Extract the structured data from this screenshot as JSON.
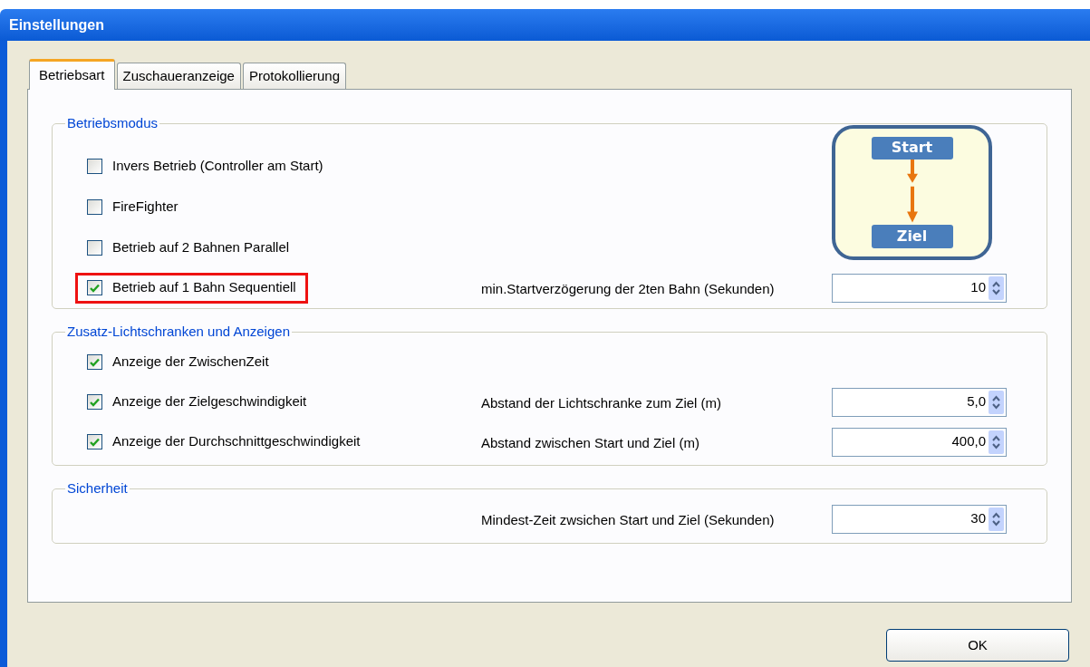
{
  "window": {
    "title": "Einstellungen"
  },
  "tabs": [
    {
      "label": "Betriebsart",
      "selected": true
    },
    {
      "label": "Zuschaueranzeige",
      "selected": false
    },
    {
      "label": "Protokollierung",
      "selected": false
    }
  ],
  "groups": [
    {
      "title": "Betriebsmodus",
      "diagram": {
        "from": "Start",
        "to": "Ziel"
      },
      "rows": [
        {
          "checkbox": {
            "label": "Invers Betrieb (Controller am Start)",
            "checked": false
          },
          "highlighted": false
        },
        {
          "checkbox": {
            "label": "FireFighter",
            "checked": false
          },
          "highlighted": false
        },
        {
          "checkbox": {
            "label": "Betrieb auf 2 Bahnen Parallel",
            "checked": false
          },
          "highlighted": false
        },
        {
          "checkbox": {
            "label": "Betrieb auf 1 Bahn Sequentiell",
            "checked": true
          },
          "highlighted": true,
          "setting": {
            "label": "min.Startverzögerung der 2ten Bahn (Sekunden)",
            "value": "10"
          }
        }
      ]
    },
    {
      "title": "Zusatz-Lichtschranken und Anzeigen",
      "rows": [
        {
          "checkbox": {
            "label": "Anzeige der ZwischenZeit",
            "checked": true
          },
          "highlighted": false
        },
        {
          "checkbox": {
            "label": "Anzeige der Zielgeschwindigkeit",
            "checked": true
          },
          "highlighted": false,
          "setting": {
            "label": "Abstand der Lichtschranke zum Ziel  (m)",
            "value": "5,0"
          }
        },
        {
          "checkbox": {
            "label": "Anzeige der Durchschnittgeschwindigkeit",
            "checked": true
          },
          "highlighted": false,
          "setting": {
            "label": "Abstand zwischen Start und Ziel (m)",
            "value": "400,0"
          }
        }
      ]
    },
    {
      "title": "Sicherheit",
      "rows": [
        {
          "highlighted": false,
          "setting": {
            "label": "Mindest-Zeit zwsichen Start und Ziel (Sekunden)",
            "value": "30"
          }
        }
      ]
    }
  ],
  "ok_button": "OK"
}
